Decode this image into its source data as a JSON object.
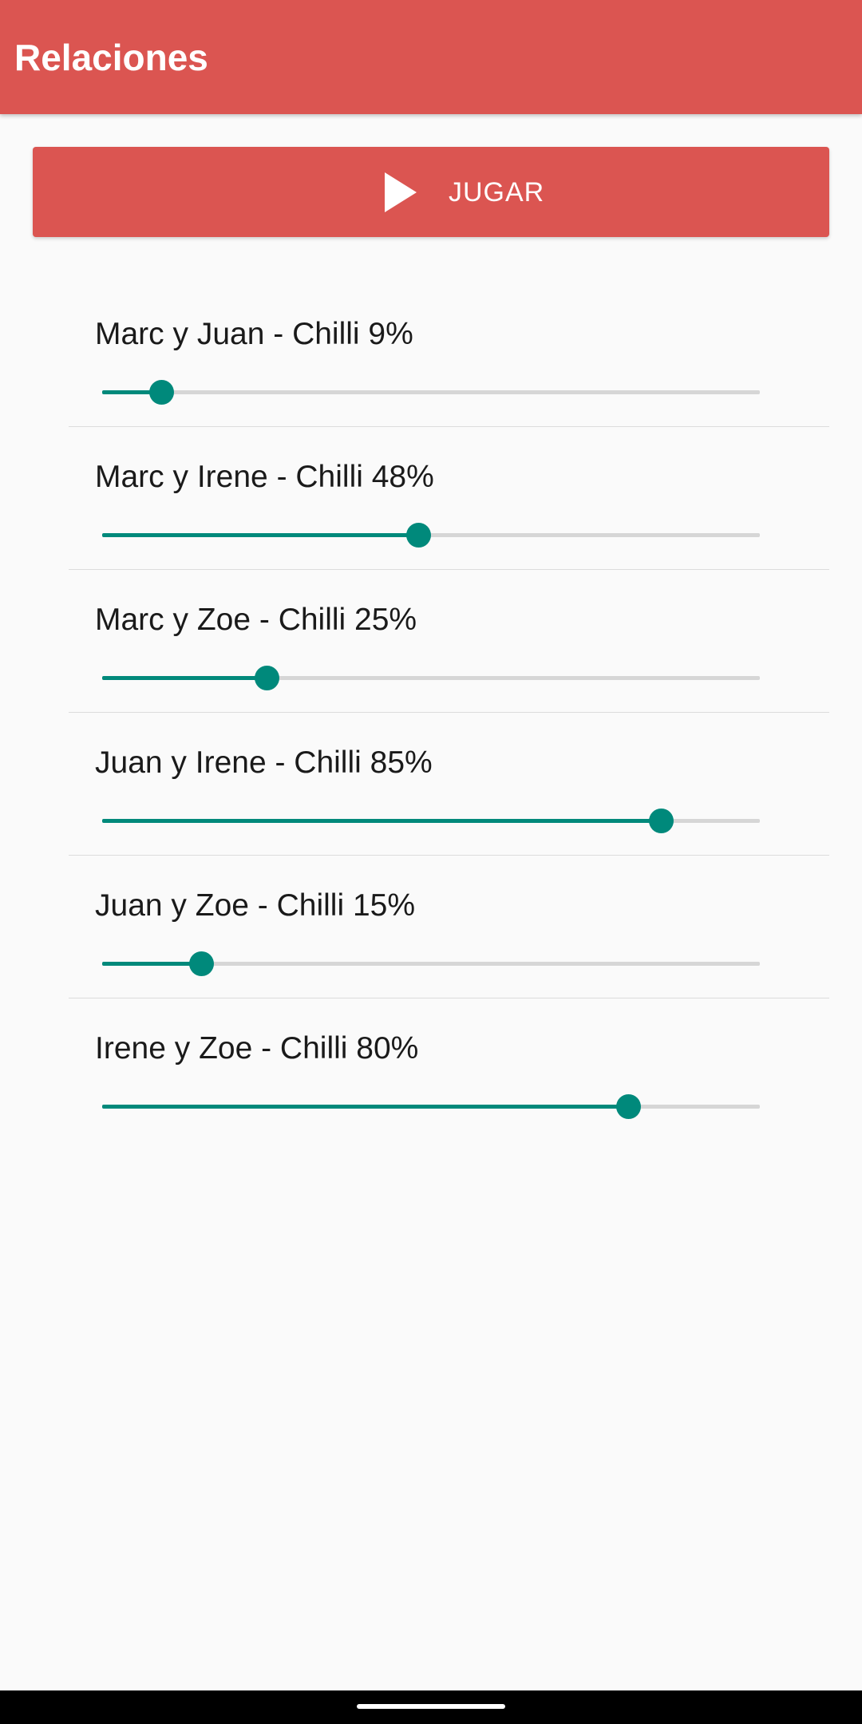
{
  "app_bar": {
    "title": "Relaciones",
    "color": "#db5551"
  },
  "play_button": {
    "label": "JUGAR",
    "icon": "play-icon"
  },
  "slider_color": "#00897b",
  "relations": [
    {
      "label": "Marc y Juan - Chilli 9%",
      "value": 9
    },
    {
      "label": "Marc y Irene - Chilli 48%",
      "value": 48
    },
    {
      "label": "Marc y Zoe - Chilli 25%",
      "value": 25
    },
    {
      "label": "Juan y Irene - Chilli 85%",
      "value": 85
    },
    {
      "label": "Juan y Zoe - Chilli 15%",
      "value": 15
    },
    {
      "label": "Irene y Zoe - Chilli 80%",
      "value": 80
    }
  ]
}
